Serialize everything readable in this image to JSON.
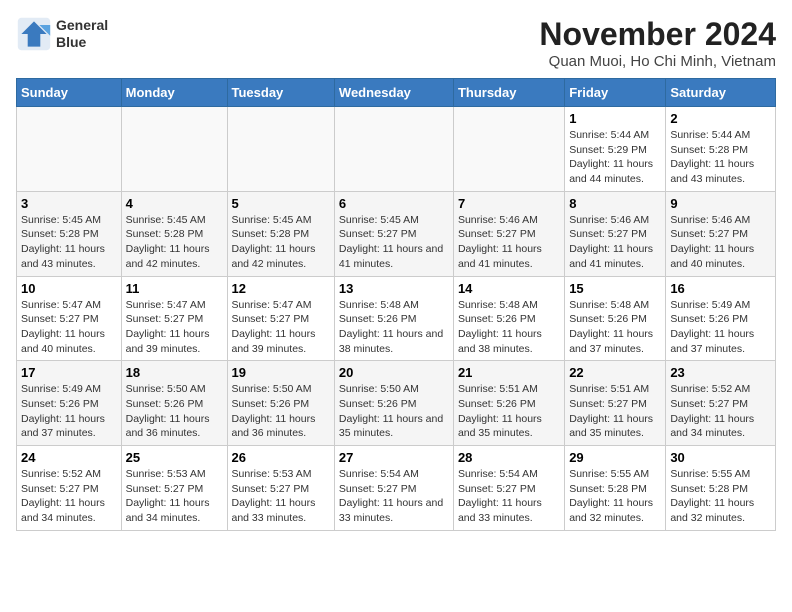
{
  "header": {
    "logo_line1": "General",
    "logo_line2": "Blue",
    "title": "November 2024",
    "location": "Quan Muoi, Ho Chi Minh, Vietnam"
  },
  "weekdays": [
    "Sunday",
    "Monday",
    "Tuesday",
    "Wednesday",
    "Thursday",
    "Friday",
    "Saturday"
  ],
  "weeks": [
    [
      {
        "day": "",
        "info": ""
      },
      {
        "day": "",
        "info": ""
      },
      {
        "day": "",
        "info": ""
      },
      {
        "day": "",
        "info": ""
      },
      {
        "day": "",
        "info": ""
      },
      {
        "day": "1",
        "info": "Sunrise: 5:44 AM\nSunset: 5:29 PM\nDaylight: 11 hours and 44 minutes."
      },
      {
        "day": "2",
        "info": "Sunrise: 5:44 AM\nSunset: 5:28 PM\nDaylight: 11 hours and 43 minutes."
      }
    ],
    [
      {
        "day": "3",
        "info": "Sunrise: 5:45 AM\nSunset: 5:28 PM\nDaylight: 11 hours and 43 minutes."
      },
      {
        "day": "4",
        "info": "Sunrise: 5:45 AM\nSunset: 5:28 PM\nDaylight: 11 hours and 42 minutes."
      },
      {
        "day": "5",
        "info": "Sunrise: 5:45 AM\nSunset: 5:28 PM\nDaylight: 11 hours and 42 minutes."
      },
      {
        "day": "6",
        "info": "Sunrise: 5:45 AM\nSunset: 5:27 PM\nDaylight: 11 hours and 41 minutes."
      },
      {
        "day": "7",
        "info": "Sunrise: 5:46 AM\nSunset: 5:27 PM\nDaylight: 11 hours and 41 minutes."
      },
      {
        "day": "8",
        "info": "Sunrise: 5:46 AM\nSunset: 5:27 PM\nDaylight: 11 hours and 41 minutes."
      },
      {
        "day": "9",
        "info": "Sunrise: 5:46 AM\nSunset: 5:27 PM\nDaylight: 11 hours and 40 minutes."
      }
    ],
    [
      {
        "day": "10",
        "info": "Sunrise: 5:47 AM\nSunset: 5:27 PM\nDaylight: 11 hours and 40 minutes."
      },
      {
        "day": "11",
        "info": "Sunrise: 5:47 AM\nSunset: 5:27 PM\nDaylight: 11 hours and 39 minutes."
      },
      {
        "day": "12",
        "info": "Sunrise: 5:47 AM\nSunset: 5:27 PM\nDaylight: 11 hours and 39 minutes."
      },
      {
        "day": "13",
        "info": "Sunrise: 5:48 AM\nSunset: 5:26 PM\nDaylight: 11 hours and 38 minutes."
      },
      {
        "day": "14",
        "info": "Sunrise: 5:48 AM\nSunset: 5:26 PM\nDaylight: 11 hours and 38 minutes."
      },
      {
        "day": "15",
        "info": "Sunrise: 5:48 AM\nSunset: 5:26 PM\nDaylight: 11 hours and 37 minutes."
      },
      {
        "day": "16",
        "info": "Sunrise: 5:49 AM\nSunset: 5:26 PM\nDaylight: 11 hours and 37 minutes."
      }
    ],
    [
      {
        "day": "17",
        "info": "Sunrise: 5:49 AM\nSunset: 5:26 PM\nDaylight: 11 hours and 37 minutes."
      },
      {
        "day": "18",
        "info": "Sunrise: 5:50 AM\nSunset: 5:26 PM\nDaylight: 11 hours and 36 minutes."
      },
      {
        "day": "19",
        "info": "Sunrise: 5:50 AM\nSunset: 5:26 PM\nDaylight: 11 hours and 36 minutes."
      },
      {
        "day": "20",
        "info": "Sunrise: 5:50 AM\nSunset: 5:26 PM\nDaylight: 11 hours and 35 minutes."
      },
      {
        "day": "21",
        "info": "Sunrise: 5:51 AM\nSunset: 5:26 PM\nDaylight: 11 hours and 35 minutes."
      },
      {
        "day": "22",
        "info": "Sunrise: 5:51 AM\nSunset: 5:27 PM\nDaylight: 11 hours and 35 minutes."
      },
      {
        "day": "23",
        "info": "Sunrise: 5:52 AM\nSunset: 5:27 PM\nDaylight: 11 hours and 34 minutes."
      }
    ],
    [
      {
        "day": "24",
        "info": "Sunrise: 5:52 AM\nSunset: 5:27 PM\nDaylight: 11 hours and 34 minutes."
      },
      {
        "day": "25",
        "info": "Sunrise: 5:53 AM\nSunset: 5:27 PM\nDaylight: 11 hours and 34 minutes."
      },
      {
        "day": "26",
        "info": "Sunrise: 5:53 AM\nSunset: 5:27 PM\nDaylight: 11 hours and 33 minutes."
      },
      {
        "day": "27",
        "info": "Sunrise: 5:54 AM\nSunset: 5:27 PM\nDaylight: 11 hours and 33 minutes."
      },
      {
        "day": "28",
        "info": "Sunrise: 5:54 AM\nSunset: 5:27 PM\nDaylight: 11 hours and 33 minutes."
      },
      {
        "day": "29",
        "info": "Sunrise: 5:55 AM\nSunset: 5:28 PM\nDaylight: 11 hours and 32 minutes."
      },
      {
        "day": "30",
        "info": "Sunrise: 5:55 AM\nSunset: 5:28 PM\nDaylight: 11 hours and 32 minutes."
      }
    ]
  ]
}
